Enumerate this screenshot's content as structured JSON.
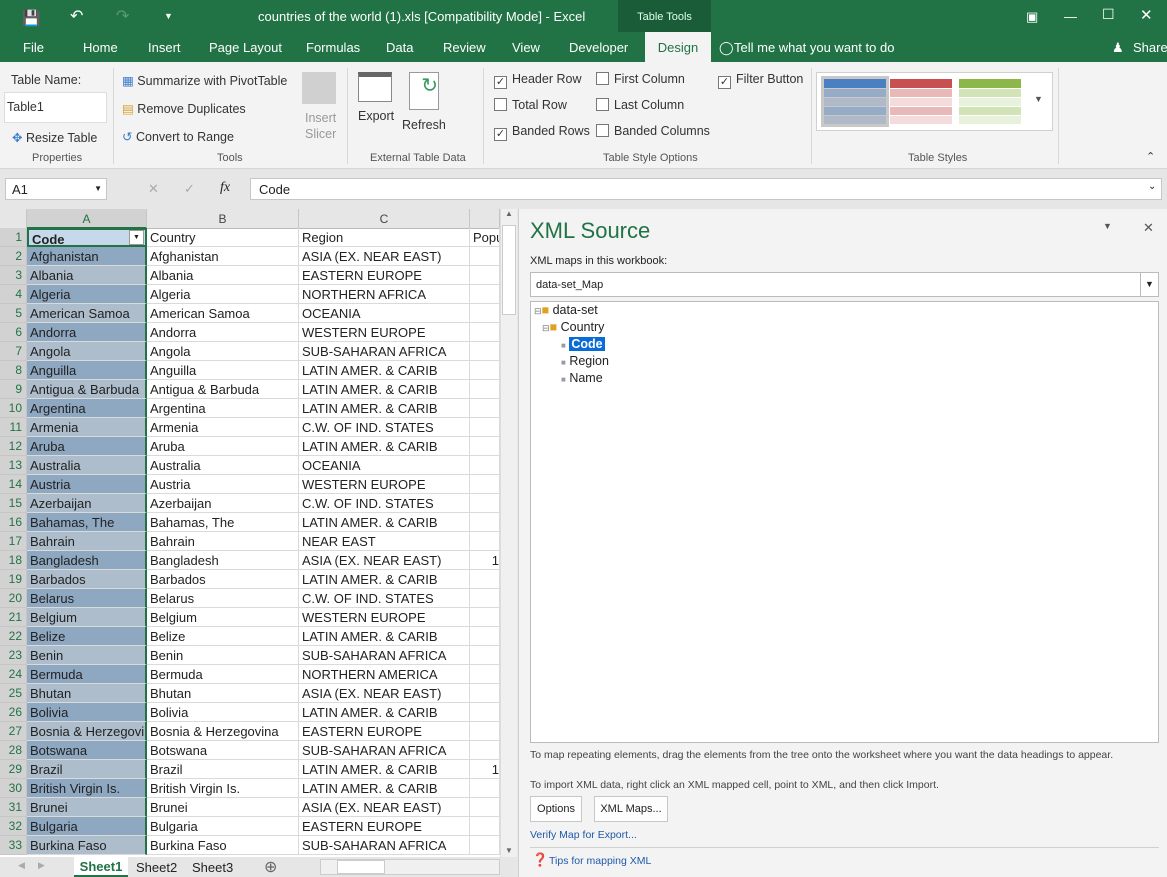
{
  "window": {
    "title": "countries of the world (1).xls  [Compatibility Mode]  -  Excel",
    "context_tab": "Table Tools"
  },
  "tabs": [
    "File",
    "Home",
    "Insert",
    "Page Layout",
    "Formulas",
    "Data",
    "Review",
    "View",
    "Developer",
    "Design"
  ],
  "tell_me": "Tell me what you want to do",
  "share": "Share",
  "ribbon": {
    "table_name_label": "Table Name:",
    "table_name": "Table1",
    "resize": "Resize Table",
    "properties": "Properties",
    "pivot": "Summarize with PivotTable",
    "remove_dup": "Remove Duplicates",
    "convert": "Convert to Range",
    "insert_slicer": [
      "Insert",
      "Slicer"
    ],
    "tools": "Tools",
    "export": "Export",
    "refresh": "Refresh",
    "external": "External Table Data",
    "options": [
      {
        "label": "Header Row",
        "checked": true
      },
      {
        "label": "Total Row",
        "checked": false
      },
      {
        "label": "Banded Rows",
        "checked": true
      },
      {
        "label": "First Column",
        "checked": false
      },
      {
        "label": "Last Column",
        "checked": false
      },
      {
        "label": "Banded Columns",
        "checked": false
      },
      {
        "label": "Filter Button",
        "checked": true
      }
    ],
    "style_options": "Table Style Options",
    "table_styles": "Table Styles",
    "style_colors": [
      "#4a7fc1",
      "#c95050",
      "#8cb84a"
    ]
  },
  "formula_bar": {
    "name_box": "A1",
    "fx": "fx",
    "value": "Code"
  },
  "columns": [
    "A",
    "B",
    "C"
  ],
  "header": [
    "Code",
    "Country",
    "Region",
    "Popu"
  ],
  "rows": [
    [
      "Afghanistan",
      "ASIA (EX. NEAR EAST)",
      ""
    ],
    [
      "Albania",
      "EASTERN EUROPE",
      ""
    ],
    [
      "Algeria",
      "NORTHERN AFRICA",
      ""
    ],
    [
      "American Samoa",
      "OCEANIA",
      ""
    ],
    [
      "Andorra",
      "WESTERN EUROPE",
      ""
    ],
    [
      "Angola",
      "SUB-SAHARAN AFRICA",
      ""
    ],
    [
      "Anguilla",
      "LATIN AMER. & CARIB",
      ""
    ],
    [
      "Antigua & Barbuda",
      "LATIN AMER. & CARIB",
      ""
    ],
    [
      "Argentina",
      "LATIN AMER. & CARIB",
      ""
    ],
    [
      "Armenia",
      "C.W. OF IND. STATES",
      ""
    ],
    [
      "Aruba",
      "LATIN AMER. & CARIB",
      ""
    ],
    [
      "Australia",
      "OCEANIA",
      ""
    ],
    [
      "Austria",
      "WESTERN EUROPE",
      ""
    ],
    [
      "Azerbaijan",
      "C.W. OF IND. STATES",
      ""
    ],
    [
      "Bahamas, The",
      "LATIN AMER. & CARIB",
      ""
    ],
    [
      "Bahrain",
      "NEAR EAST",
      ""
    ],
    [
      "Bangladesh",
      "ASIA (EX. NEAR EAST)",
      "1"
    ],
    [
      "Barbados",
      "LATIN AMER. & CARIB",
      ""
    ],
    [
      "Belarus",
      "C.W. OF IND. STATES",
      ""
    ],
    [
      "Belgium",
      "WESTERN EUROPE",
      ""
    ],
    [
      "Belize",
      "LATIN AMER. & CARIB",
      ""
    ],
    [
      "Benin",
      "SUB-SAHARAN AFRICA",
      ""
    ],
    [
      "Bermuda",
      "NORTHERN AMERICA",
      ""
    ],
    [
      "Bhutan",
      "ASIA (EX. NEAR EAST)",
      ""
    ],
    [
      "Bolivia",
      "LATIN AMER. & CARIB",
      ""
    ],
    [
      "Bosnia & Herzegovina",
      "EASTERN EUROPE",
      ""
    ],
    [
      "Botswana",
      "SUB-SAHARAN AFRICA",
      ""
    ],
    [
      "Brazil",
      "LATIN AMER. & CARIB",
      "1"
    ],
    [
      "British Virgin Is.",
      "LATIN AMER. & CARIB",
      ""
    ],
    [
      "Brunei",
      "ASIA (EX. NEAR EAST)",
      ""
    ],
    [
      "Bulgaria",
      "EASTERN EUROPE",
      ""
    ],
    [
      "Burkina Faso",
      "SUB-SAHARAN AFRICA",
      ""
    ]
  ],
  "sheets": [
    "Sheet1",
    "Sheet2",
    "Sheet3"
  ],
  "xml": {
    "title": "XML Source",
    "maps_label": "XML maps in this workbook:",
    "map": "data-set_Map",
    "tree": [
      "data-set",
      "Country",
      "Code",
      "Region",
      "Name"
    ],
    "hint1": "To map repeating elements, drag the elements from the tree onto the worksheet where you want the data headings to appear.",
    "hint2": "To import XML data, right click an XML mapped cell, point to XML, and then click Import.",
    "options": "Options",
    "xml_maps": "XML Maps...",
    "verify": "Verify Map for Export...",
    "tips": "Tips for mapping XML"
  }
}
